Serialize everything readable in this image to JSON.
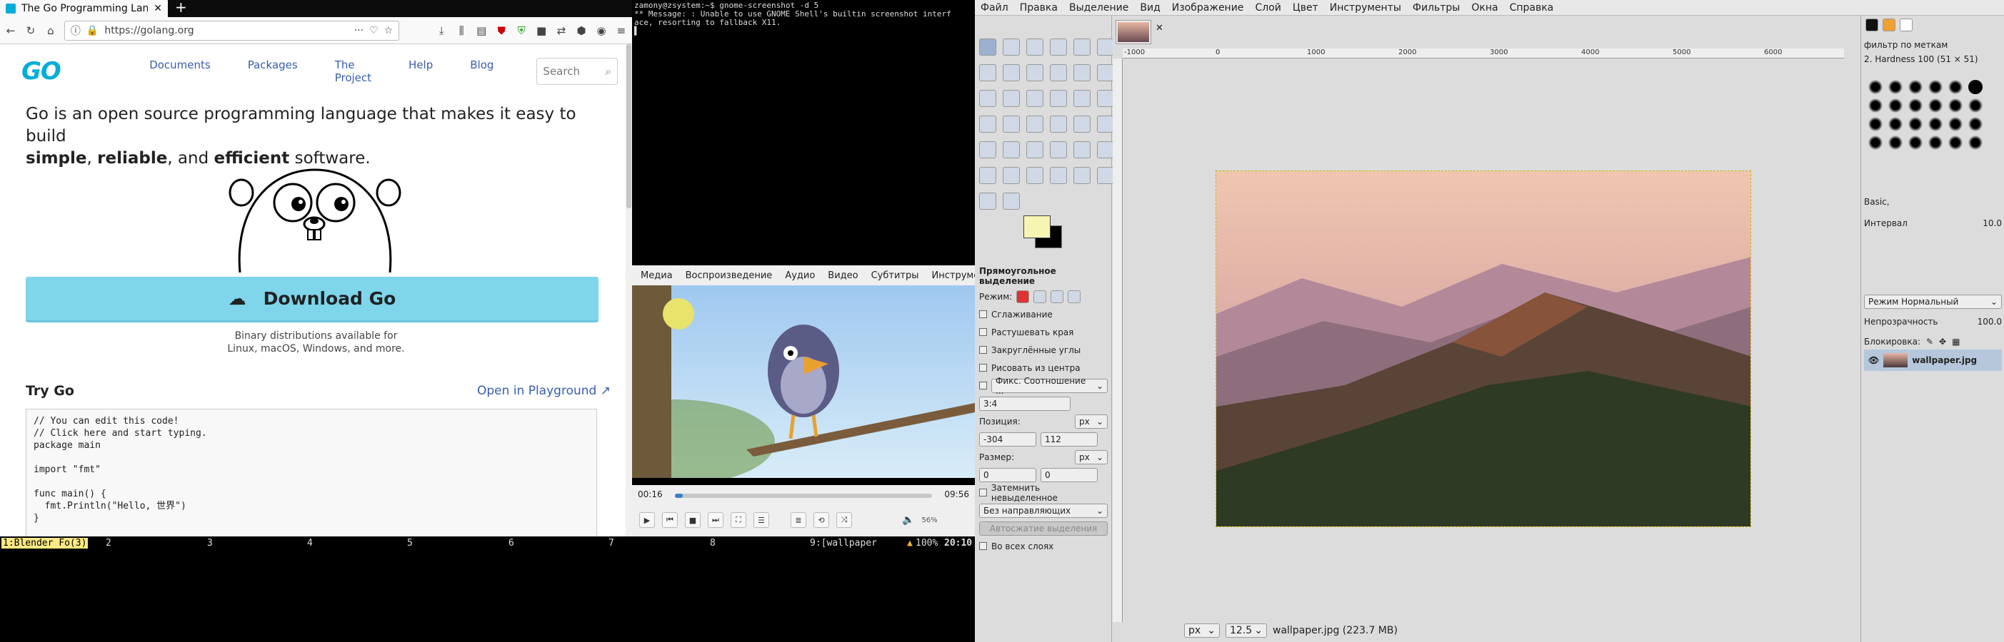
{
  "firefox": {
    "tab_title": "The Go Programming Lan",
    "url": "https://golang.org",
    "logo": "GO",
    "nav": [
      "Documents",
      "Packages",
      "The Project",
      "Help",
      "Blog"
    ],
    "search_placeholder": "Search",
    "tagline_parts": [
      "Go is an open source programming language that makes it easy to build ",
      "simple",
      ", ",
      "reliable",
      ", and ",
      "efficient",
      " software."
    ],
    "download_label": "Download Go",
    "download_sub_1": "Binary distributions available for",
    "download_sub_2": "Linux, macOS, Windows, and more.",
    "try_go": "Try Go",
    "playground_link": "Open in Playground",
    "code": "// You can edit this code!\n// Click here and start typing.\npackage main\n\nimport \"fmt\"\n\nfunc main() {\n  fmt.Println(\"Hello, 世界\")\n}"
  },
  "terminal": {
    "lines": "zamony@zsystem:~$ gnome-screenshot -d 5\n** Message: : Unable to use GNOME Shell's builtin screenshot interf\nace, resorting to fallback X11.\n▌"
  },
  "vlc": {
    "menu": [
      "Медиа",
      "Воспроизведение",
      "Аудио",
      "Видео",
      "Субтитры",
      "Инструменты"
    ],
    "time_elapsed": "00:16",
    "time_total": "09:56",
    "progress": 0.03,
    "volume": "56%"
  },
  "statusbar": {
    "workspaces": [
      "1:Blender Fo(3)",
      "2",
      "3",
      "4",
      "5",
      "6",
      "7",
      "8",
      "9:[wallpaper"
    ],
    "battery": "100%",
    "clock": "20:10"
  },
  "gimp": {
    "menu": [
      "Файл",
      "Правка",
      "Выделение",
      "Вид",
      "Изображение",
      "Слой",
      "Цвет",
      "Инструменты",
      "Фильтры",
      "Окна",
      "Справка"
    ],
    "tool_options_title": "Прямоугольное выделение",
    "mode_label": "Режим:",
    "options": [
      "Сглаживание",
      "Растушевать края",
      "Закруглённые углы",
      "Рисовать из центра"
    ],
    "fixed_label": "Фикс. Соотношение ...",
    "ratio": "3:4",
    "position_label": "Позиция:",
    "pos_x": "-304",
    "pos_y": "112",
    "size_label": "Размер:",
    "size_w": "0",
    "size_h": "0",
    "unit": "px",
    "darken": "Затемнить невыделенное",
    "guides": "Без направляющих",
    "autoshrink": "Автосжатие выделения",
    "all_layers": "Во всех слоях",
    "ruler_ticks": [
      "-1000",
      "0",
      "1000",
      "2000",
      "3000",
      "4000",
      "5000",
      "6000"
    ],
    "zoom": "12.5",
    "status_unit": "px",
    "status_file": "wallpaper.jpg (223.7 MB)",
    "brush_filter": "фильтр по меткам",
    "brush_name": "2. Hardness 100 (51 × 51)",
    "brush_preset": "Basic,",
    "interval_label": "Интервал",
    "interval_value": "10.0",
    "layer_mode": "Режим Нормальный",
    "opacity_label": "Непрозрачность",
    "opacity_value": "100.0",
    "lock_label": "Блокировка:",
    "layer_name": "wallpaper.jpg"
  }
}
